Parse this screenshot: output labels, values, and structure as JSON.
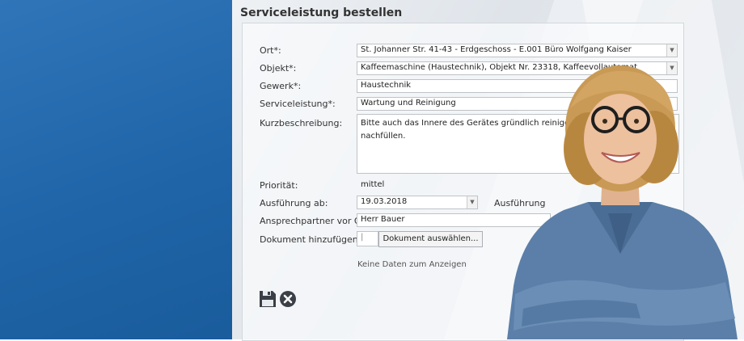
{
  "title": "Serviceleistung bestellen",
  "fields": {
    "ort": {
      "label": "Ort*:",
      "value": "St. Johanner Str.  41-43 - Erdgeschoss - E.001 Büro Wolfgang Kaiser"
    },
    "objekt": {
      "label": "Objekt*:",
      "value": "Kaffeemaschine (Haustechnik), Objekt Nr.  23318, Kaffeevollautomat"
    },
    "gewerk": {
      "label": "Gewerk*:",
      "value": "Haustechnik"
    },
    "serviceleistung": {
      "label": "Serviceleistung*:",
      "value": "Wartung und Reinigung"
    },
    "kurzbeschreibung": {
      "label": "Kurzbeschreibung:",
      "value_line1": "Bitte auch das Innere des Gerätes gründlich reinigen und die Bohnen",
      "value_line2": "nachfüllen."
    },
    "prioritaet": {
      "label": "Priorität:",
      "value": "mittel"
    },
    "ausfuehrung_ab": {
      "label": "Ausführung ab:",
      "value": "19.03.2018"
    },
    "ausfuehrung_bis": {
      "label": "Ausführung"
    },
    "ansprechpartner": {
      "label": "Ansprechpartner vor Ort:",
      "value": "Herr Bauer"
    },
    "dokument": {
      "label": "Dokument hinzufügen:",
      "button": "Dokument auswählen..."
    }
  },
  "no_data_text": "Keine Daten zum Anzeigen",
  "icons": {
    "save": "save-icon",
    "cancel": "cancel-icon"
  },
  "colors": {
    "left_panel": "#2a6fb0",
    "icon_dark": "#3a3f48"
  }
}
